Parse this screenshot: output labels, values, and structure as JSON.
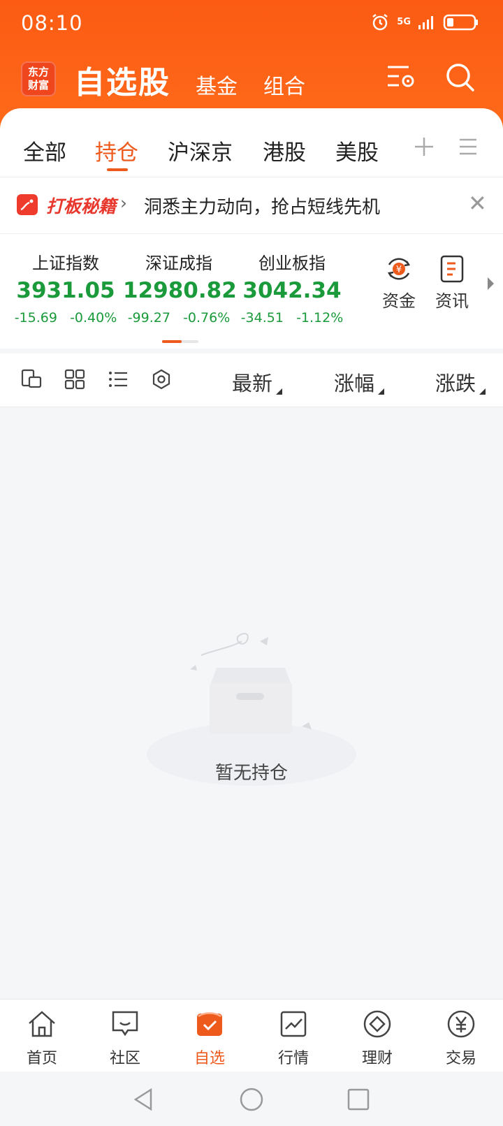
{
  "status_bar": {
    "time": "08:10",
    "network": "5G"
  },
  "header": {
    "logo_text_line1": "东方",
    "logo_text_line2": "财富",
    "title": "自选股",
    "links": [
      "基金",
      "组合"
    ]
  },
  "tabs": [
    {
      "label": "全部"
    },
    {
      "label": "持仓"
    },
    {
      "label": "沪深京"
    },
    {
      "label": "港股"
    },
    {
      "label": "美股"
    }
  ],
  "active_tab": "持仓",
  "banner": {
    "brand": "打板秘籍",
    "message": "洞悉主力动向，抢占短线先机"
  },
  "indices": [
    {
      "name": "上证指数",
      "value": "3931.05",
      "change": "-15.69",
      "percent": "-0.40%"
    },
    {
      "name": "深证成指",
      "value": "12980.82",
      "change": "-99.27",
      "percent": "-0.76%"
    },
    {
      "name": "创业板指",
      "value": "3042.34",
      "change": "-34.51",
      "percent": "-1.12%"
    }
  ],
  "quick_actions": [
    {
      "label": "资金",
      "icon": "yuan-cycle-icon"
    },
    {
      "label": "资讯",
      "icon": "document-icon"
    }
  ],
  "sort_columns": [
    "最新",
    "涨幅",
    "涨跌"
  ],
  "empty_state": {
    "text": "暂无持仓"
  },
  "bottom_nav": [
    {
      "label": "首页",
      "icon": "home-icon"
    },
    {
      "label": "社区",
      "icon": "chat-icon"
    },
    {
      "label": "自选",
      "icon": "checkbox-icon"
    },
    {
      "label": "行情",
      "icon": "trend-chart-icon"
    },
    {
      "label": "理财",
      "icon": "diamond-icon"
    },
    {
      "label": "交易",
      "icon": "yuan-circle-icon"
    }
  ],
  "colors": {
    "accent": "#ee5a1c",
    "header": "#fb5b13",
    "down_green": "#1a9a3a",
    "banner_red": "#e8372c"
  }
}
